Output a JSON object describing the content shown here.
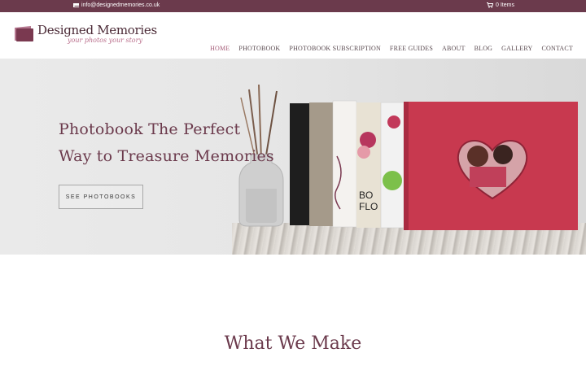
{
  "topbar": {
    "email": "info@designedmemories.co.uk",
    "cart": "0 Items"
  },
  "logo": {
    "title": "Designed Memories",
    "tagline": "your photos your story"
  },
  "nav": {
    "items": [
      "HOME",
      "PHOTOBOOK",
      "PHOTOBOOK SUBSCRIPTION",
      "FREE GUIDES",
      "ABOUT",
      "BLOG",
      "GALLERY",
      "CONTACT"
    ],
    "active": "HOME"
  },
  "hero": {
    "headline_line1": "Photobook The Perfect",
    "headline_line2": "Way to Treasure Memories",
    "cta": "SEE PHOTOBOOKS"
  },
  "section": {
    "title": "What We Make"
  },
  "colors": {
    "brand": "#6b3a4c",
    "accent": "#a55c78",
    "album_red": "#c8394f"
  }
}
